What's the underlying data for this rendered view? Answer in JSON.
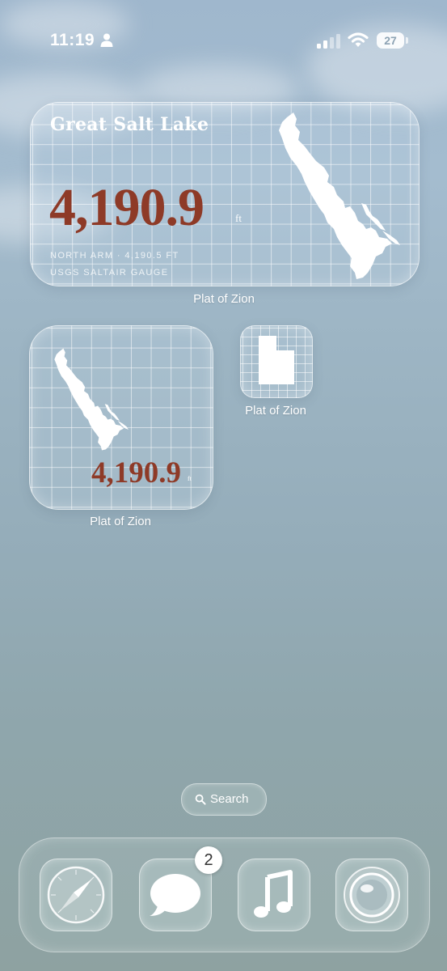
{
  "status_bar": {
    "time": "11:19",
    "battery_level": "27",
    "icons": [
      "person-icon",
      "cellular-signal-icon",
      "wifi-icon",
      "battery-icon"
    ]
  },
  "widget_large": {
    "title": "Great Salt Lake",
    "value": "4,190.9",
    "unit": "ft",
    "line1": "NORTH ARM · 4,190.5 FT",
    "line2": "USGS SALTAIR GAUGE",
    "label": "Plat of Zion",
    "value_color": "#8e3a27",
    "icon": "great-salt-lake-silhouette"
  },
  "widget_medium": {
    "value": "4,190.9",
    "unit": "ft",
    "label": "Plat of Zion",
    "icon": "great-salt-lake-silhouette"
  },
  "widget_small": {
    "label": "Plat of Zion",
    "icon": "utah-state-silhouette"
  },
  "search": {
    "label": "Search",
    "icon": "magnifying-glass-icon"
  },
  "dock": {
    "apps": [
      {
        "name": "Safari",
        "icon": "compass-icon"
      },
      {
        "name": "Messages",
        "icon": "speech-bubble-icon",
        "badge": "2"
      },
      {
        "name": "Music",
        "icon": "music-note-icon"
      },
      {
        "name": "Camera",
        "icon": "camera-lens-icon"
      }
    ]
  }
}
